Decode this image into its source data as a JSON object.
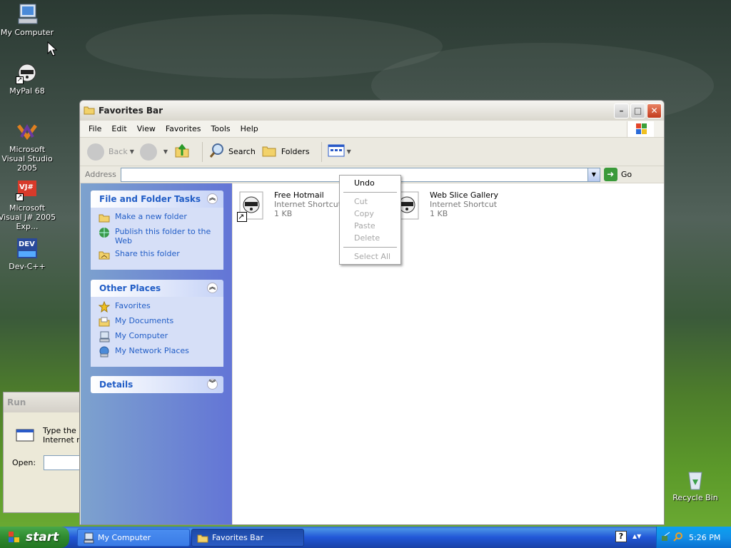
{
  "desktop": {
    "icons": [
      {
        "label": "My Computer"
      },
      {
        "label": "MyPal 68"
      },
      {
        "label": "Microsoft Visual Studio 2005"
      },
      {
        "label": "Microsoft Visual J# 2005 Exp..."
      },
      {
        "label": "Dev-C++"
      },
      {
        "label": "Recycle Bin"
      }
    ],
    "devcpp_badge": "DEV",
    "vj_badge": "VJ#"
  },
  "run_dialog": {
    "title": "Run",
    "text_line1": "Type the n",
    "text_line2": "Internet re",
    "open_label": "Open:"
  },
  "window": {
    "title": "Favorites Bar",
    "menu": [
      "File",
      "Edit",
      "View",
      "Favorites",
      "Tools",
      "Help"
    ],
    "toolbar": {
      "back": "Back",
      "search": "Search",
      "folders": "Folders"
    },
    "address": {
      "label": "Address",
      "value": "",
      "go": "Go"
    },
    "tasks": {
      "file_folder_tasks": {
        "title": "File and Folder Tasks",
        "items": [
          "Make a new folder",
          "Publish this folder to the Web",
          "Share this folder"
        ]
      },
      "other_places": {
        "title": "Other Places",
        "items": [
          "Favorites",
          "My Documents",
          "My Computer",
          "My Network Places"
        ]
      },
      "details": {
        "title": "Details"
      }
    },
    "files": [
      {
        "name": "Free Hotmail",
        "type": "Internet Shortcut",
        "size": "1 KB"
      },
      {
        "name": "Web Slice Gallery",
        "type": "Internet Shortcut",
        "size": "1 KB"
      }
    ]
  },
  "context_menu": {
    "undo": "Undo",
    "cut": "Cut",
    "copy": "Copy",
    "paste": "Paste",
    "delete": "Delete",
    "select_all": "Select All"
  },
  "taskbar": {
    "start": "start",
    "buttons": [
      "My Computer",
      "Favorites Bar"
    ],
    "clock": "5:26 PM",
    "help": "?"
  }
}
